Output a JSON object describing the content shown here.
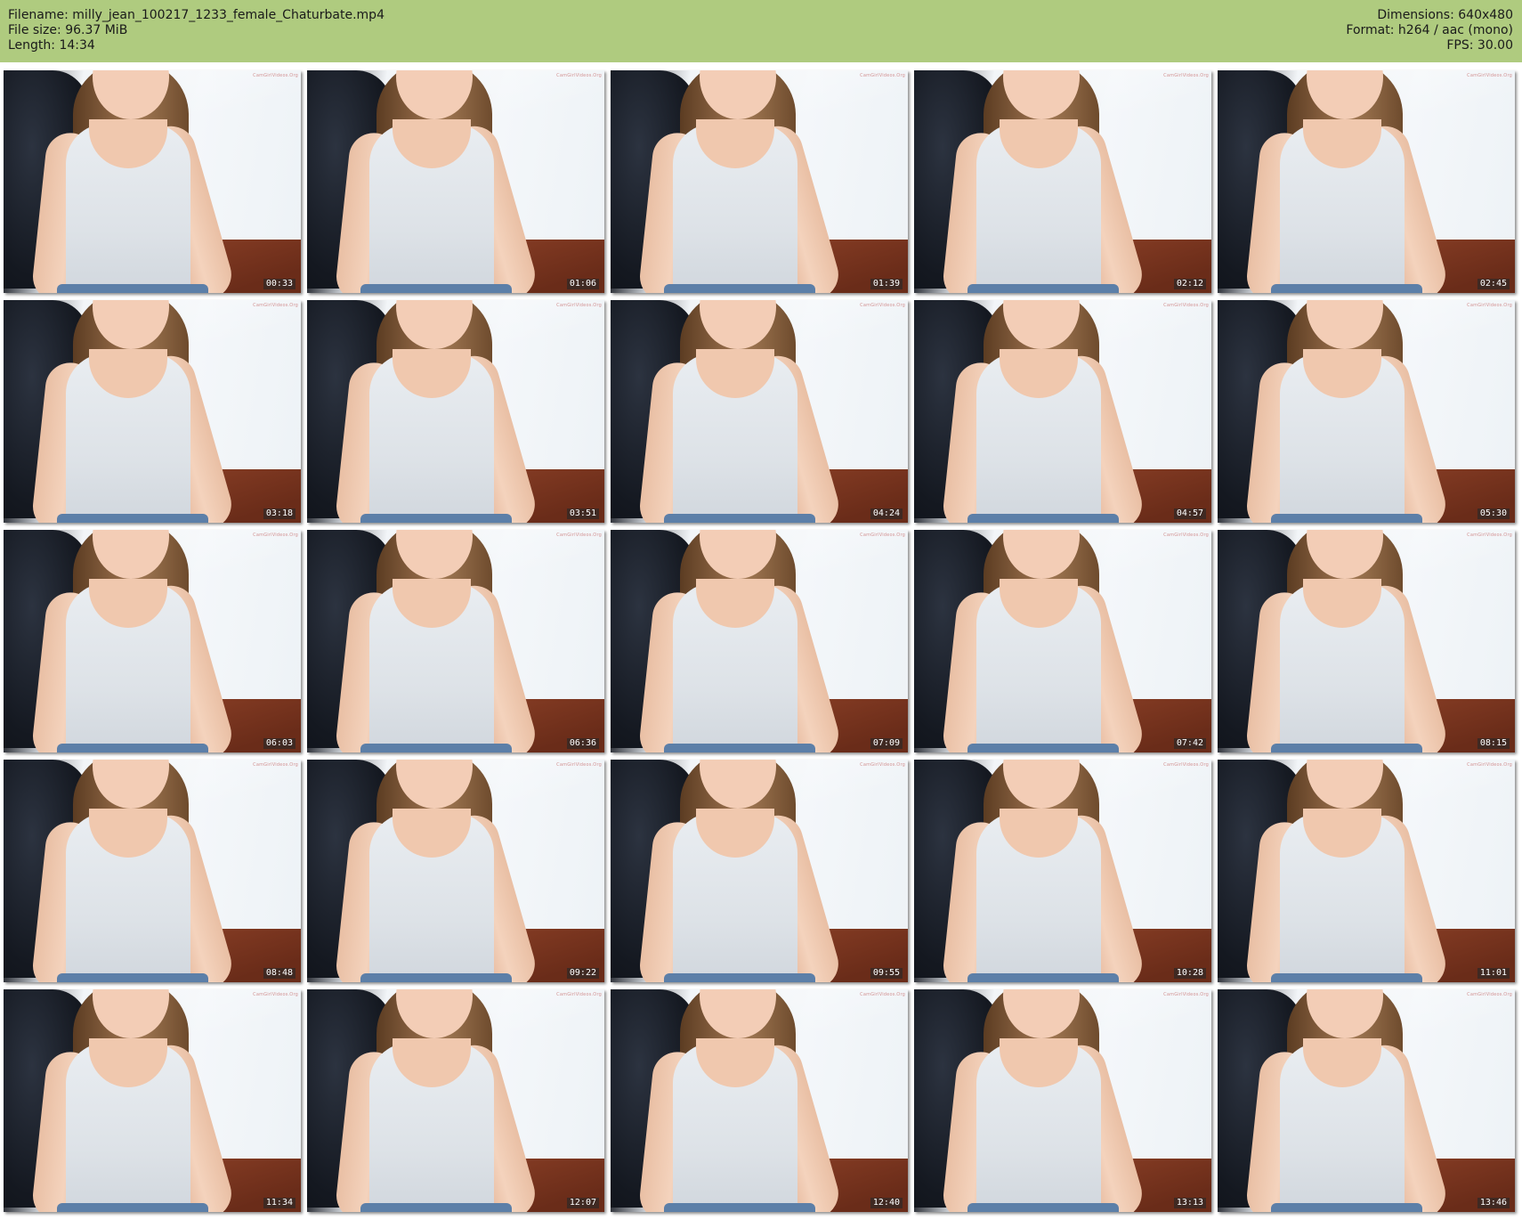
{
  "header": {
    "filename": "Filename: milly_jean_100217_1233_female_Chaturbate.mp4",
    "file_size": "File size: 96.37 MiB",
    "length": "Length: 14:34",
    "dimensions": "Dimensions: 640x480",
    "format": "Format: h264 / aac (mono)",
    "fps": "FPS: 30.00",
    "background_color": "#afcb7f"
  },
  "watermark_text": "CamGirlVideos.Org",
  "thumbnails": [
    {
      "timestamp": "00:33"
    },
    {
      "timestamp": "01:06"
    },
    {
      "timestamp": "01:39"
    },
    {
      "timestamp": "02:12"
    },
    {
      "timestamp": "02:45"
    },
    {
      "timestamp": "03:18"
    },
    {
      "timestamp": "03:51"
    },
    {
      "timestamp": "04:24"
    },
    {
      "timestamp": "04:57"
    },
    {
      "timestamp": "05:30"
    },
    {
      "timestamp": "06:03"
    },
    {
      "timestamp": "06:36"
    },
    {
      "timestamp": "07:09"
    },
    {
      "timestamp": "07:42"
    },
    {
      "timestamp": "08:15"
    },
    {
      "timestamp": "08:48"
    },
    {
      "timestamp": "09:22"
    },
    {
      "timestamp": "09:55"
    },
    {
      "timestamp": "10:28"
    },
    {
      "timestamp": "11:01"
    },
    {
      "timestamp": "11:34"
    },
    {
      "timestamp": "12:07"
    },
    {
      "timestamp": "12:40"
    },
    {
      "timestamp": "13:13"
    },
    {
      "timestamp": "13:46"
    }
  ]
}
